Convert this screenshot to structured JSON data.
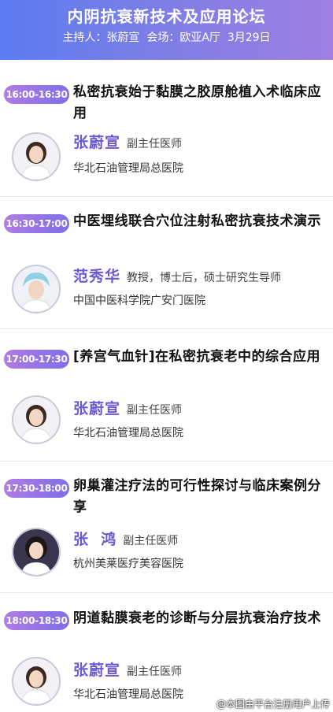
{
  "header": {
    "title": "内阴抗衰新技术及应用论坛",
    "subtitle": "主持人：张蔚宣  会场：欧亚A厅  3月29日"
  },
  "sessions": [
    {
      "time": "16:00-16:30",
      "title": "私密抗衰始于黏膜之胶原舱植入术临床应用",
      "speaker": "张蔚宣",
      "role": "副主任医师",
      "hospital": "华北石油管理局总医院"
    },
    {
      "time": "16:30-17:00",
      "title": "中医埋线联合穴位注射私密抗衰技术演示",
      "speaker": "范秀华",
      "role": "教授，博士后，硕士研究生导师",
      "hospital": "中国中医科学院广安门医院"
    },
    {
      "time": "17:00-17:30",
      "title": "[养宫气血针]在私密抗衰老中的综合应用",
      "speaker": "张蔚宣",
      "role": "副主任医师",
      "hospital": "华北石油管理局总医院"
    },
    {
      "time": "17:30-18:00",
      "title": "卵巢灌注疗法的可行性探讨与临床案例分享",
      "speaker": "张  鸿",
      "role": "副主任医师",
      "hospital": "杭州美莱医疗美容医院"
    },
    {
      "time": "18:00-18:30",
      "title": "阴道黏膜衰老的诊断与分层抗衰治疗技术",
      "speaker": "张蔚宣",
      "role": "副主任医师",
      "hospital": "华北石油管理局总医院"
    }
  ],
  "watermark": "@本图由平台注册用户上传"
}
